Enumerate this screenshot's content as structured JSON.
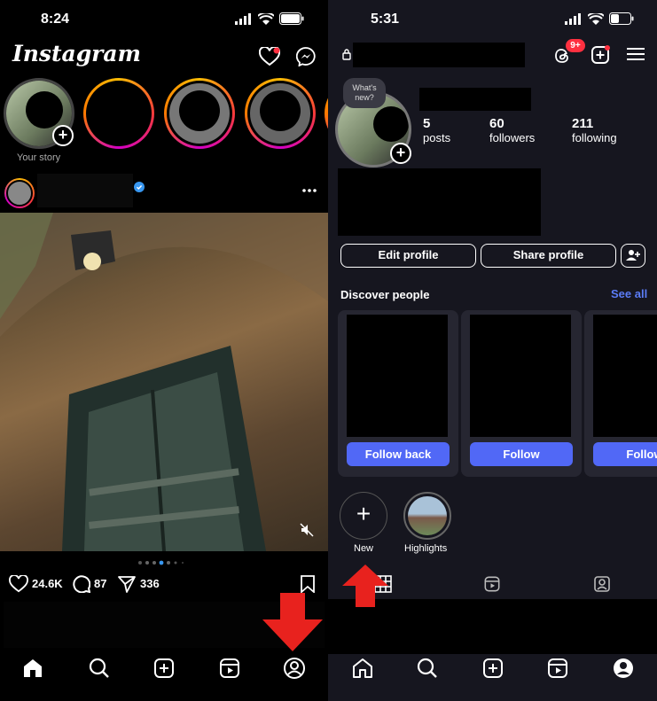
{
  "left": {
    "status_time": "8:24",
    "logo": "Instagram",
    "your_story_label": "Your story",
    "post_actions": {
      "likes": "24.6K",
      "comments": "87",
      "shares": "336"
    },
    "icons": {
      "heart": "heart-icon",
      "messenger": "messenger-icon",
      "verified": "verified-badge-icon",
      "more": "more-icon",
      "mute": "mute-icon",
      "save": "bookmark-icon"
    },
    "bottom_nav": [
      "home-icon",
      "search-icon",
      "create-icon",
      "reels-icon",
      "profile-icon"
    ]
  },
  "right": {
    "status_time": "5:31",
    "threads_badge": "9+",
    "note_bubble": "What's new?",
    "stats": [
      {
        "value": "5",
        "label": "posts"
      },
      {
        "value": "60",
        "label": "followers"
      },
      {
        "value": "211",
        "label": "following"
      }
    ],
    "edit_profile": "Edit profile",
    "share_profile": "Share profile",
    "discover_title": "Discover people",
    "see_all": "See all",
    "cards": [
      {
        "button": "Follow back"
      },
      {
        "button": "Follow"
      },
      {
        "button": "Follow"
      }
    ],
    "highlights": [
      {
        "label": "New"
      },
      {
        "label": "Highlights"
      }
    ],
    "accent_color": "#5168f6",
    "bottom_nav": [
      "home-icon",
      "search-icon",
      "create-icon",
      "reels-icon",
      "profile-icon"
    ]
  },
  "annotation_color": "#e8221e"
}
